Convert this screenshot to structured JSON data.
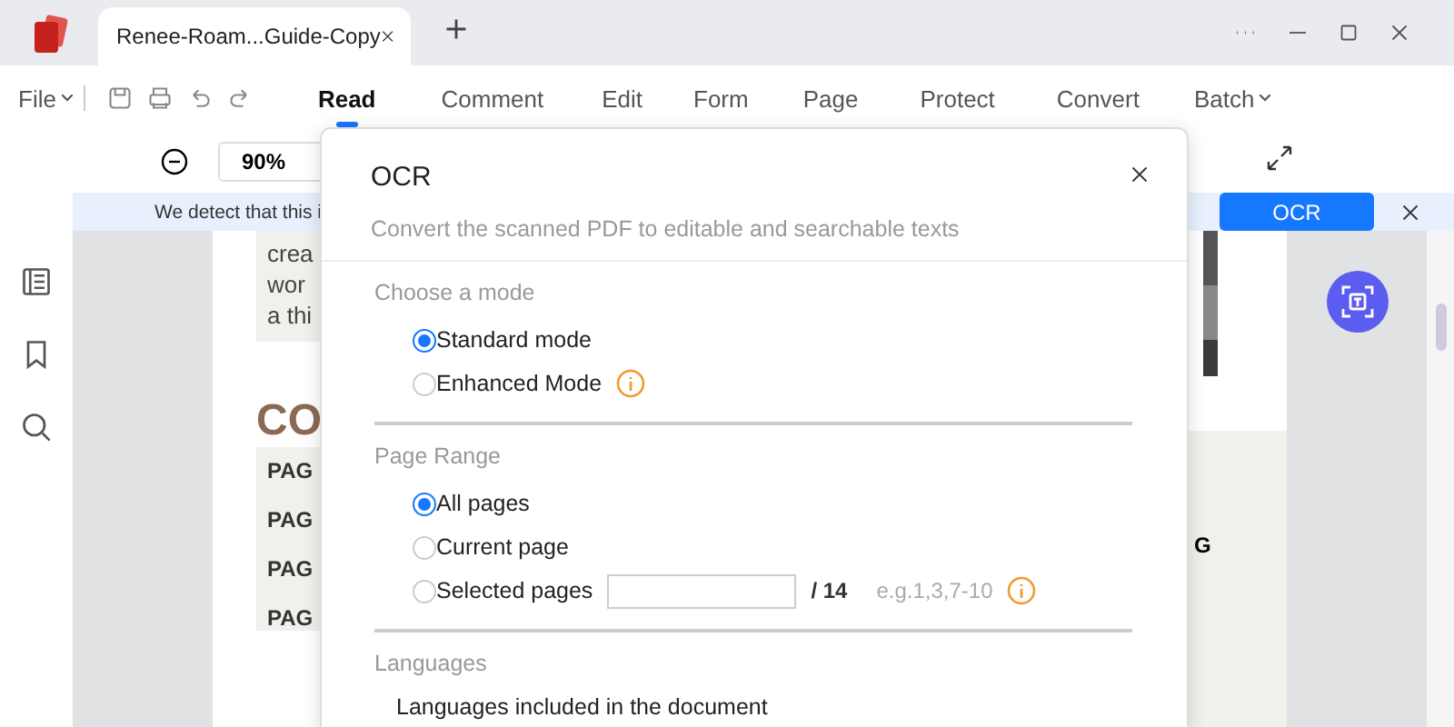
{
  "tab": {
    "title": "Renee-Roam...Guide-Copy"
  },
  "menu": {
    "file": "File",
    "tabs": [
      {
        "label": "Read",
        "selected": true
      },
      {
        "label": "Comment",
        "selected": false
      },
      {
        "label": "Edit",
        "selected": false
      },
      {
        "label": "Form",
        "selected": false
      },
      {
        "label": "Page",
        "selected": false
      },
      {
        "label": "Protect",
        "selected": false
      },
      {
        "label": "Convert",
        "selected": false
      },
      {
        "label": "Batch",
        "selected": false
      }
    ]
  },
  "toolbar": {
    "zoom": "90%"
  },
  "notice": {
    "text": "We detect that this i",
    "button": "OCR"
  },
  "document": {
    "lines": [
      "crea",
      "wor",
      "a thi"
    ],
    "heading": "CO",
    "rows": [
      "PAG",
      "PAG",
      "PAG",
      "PAG"
    ],
    "right_text": "G"
  },
  "dialog": {
    "title": "OCR",
    "subtitle": "Convert the scanned PDF to editable and searchable texts",
    "mode": {
      "label": "Choose a mode",
      "options": [
        {
          "label": "Standard mode",
          "selected": true,
          "info": false
        },
        {
          "label": "Enhanced Mode",
          "selected": false,
          "info": true
        }
      ]
    },
    "range": {
      "label": "Page Range",
      "options": [
        {
          "label": "All pages",
          "selected": true
        },
        {
          "label": "Current page",
          "selected": false
        },
        {
          "label": "Selected pages",
          "selected": false
        }
      ],
      "total": "/ 14",
      "hint": "e.g.1,3,7-10"
    },
    "languages": {
      "label": "Languages",
      "text": "Languages included in the document"
    }
  }
}
